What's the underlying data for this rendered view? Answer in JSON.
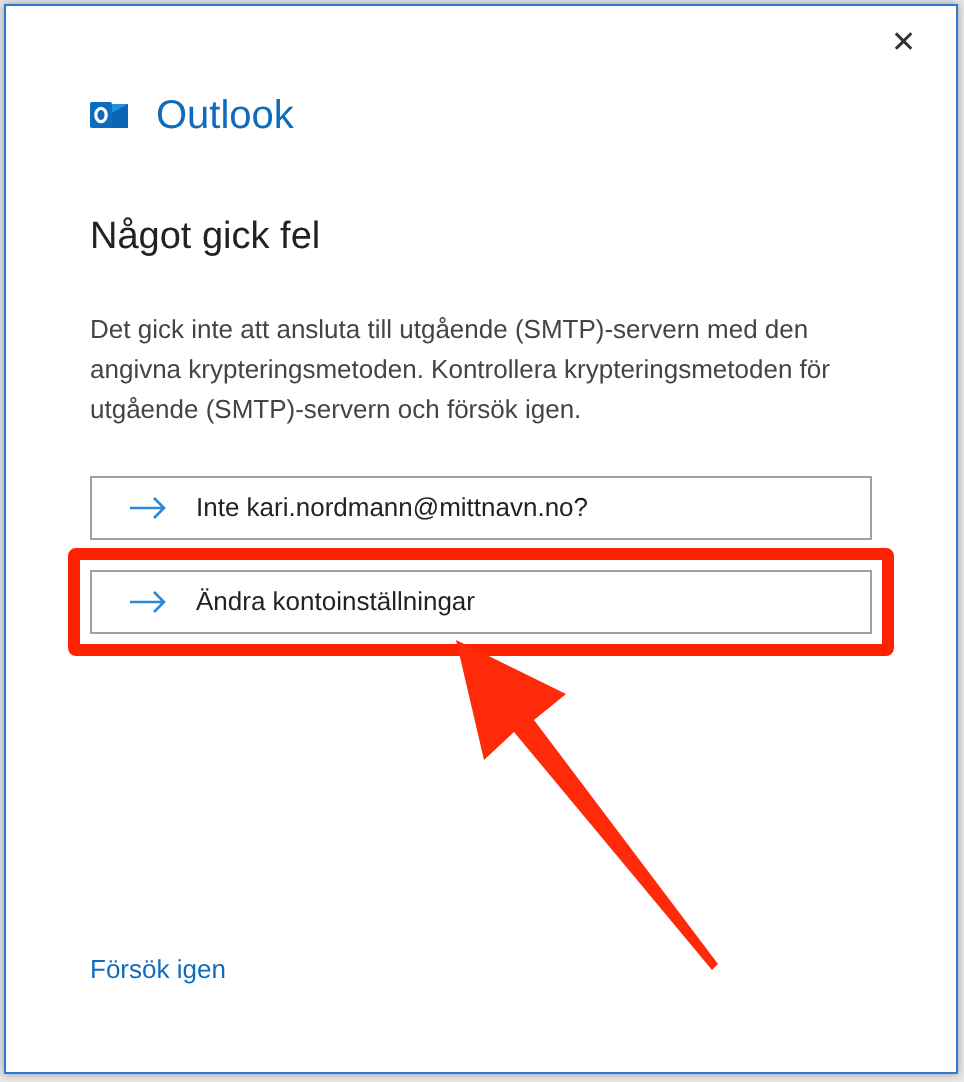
{
  "window": {
    "close": "✕"
  },
  "app": {
    "name": "Outlook"
  },
  "heading": "Något gick fel",
  "message": "Det gick inte att ansluta till utgående (SMTP)-servern med den angivna krypteringsmetoden. Kontrollera krypteringsmetoden för utgående (SMTP)-servern och försök igen.",
  "options": [
    {
      "label": "Inte kari.nordmann@mittnavn.no?",
      "highlighted": false
    },
    {
      "label": "Ändra kontoinställningar",
      "highlighted": true
    }
  ],
  "retry_link": "Försök igen"
}
